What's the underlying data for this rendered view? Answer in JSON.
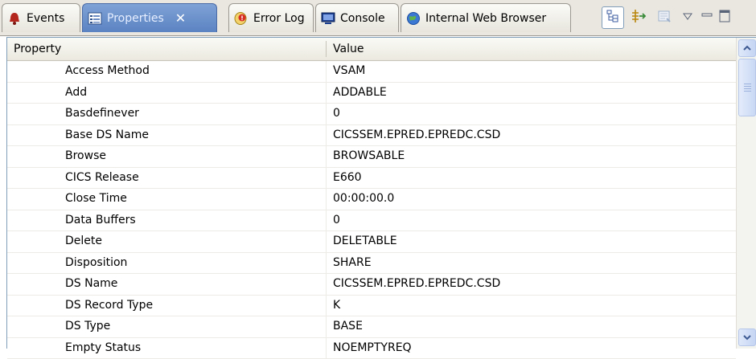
{
  "tabs": [
    {
      "label": "Events",
      "icon": "bell-icon"
    },
    {
      "label": "Properties",
      "icon": "properties-icon",
      "active": true
    },
    {
      "label": "Error Log",
      "icon": "error-log-icon"
    },
    {
      "label": "Console",
      "icon": "console-icon"
    },
    {
      "label": "Internal Web Browser",
      "icon": "globe-icon"
    }
  ],
  "toolbar": [
    {
      "icon": "show-categories-icon"
    },
    {
      "icon": "show-advanced-properties-icon"
    },
    {
      "icon": "restore-default-icon"
    },
    {
      "icon": "view-menu-icon"
    },
    {
      "icon": "minimize-icon"
    },
    {
      "icon": "maximize-icon"
    }
  ],
  "table": {
    "headers": {
      "property": "Property",
      "value": "Value"
    },
    "rows": [
      {
        "property": "Access Method",
        "value": "VSAM"
      },
      {
        "property": "Add",
        "value": "ADDABLE"
      },
      {
        "property": "Basdefinever",
        "value": "0"
      },
      {
        "property": "Base DS Name",
        "value": "CICSSEM.EPRED.EPREDC.CSD"
      },
      {
        "property": "Browse",
        "value": "BROWSABLE"
      },
      {
        "property": "CICS Release",
        "value": "E660"
      },
      {
        "property": "Close Time",
        "value": "00:00:00.0"
      },
      {
        "property": "Data Buffers",
        "value": "0"
      },
      {
        "property": "Delete",
        "value": "DELETABLE"
      },
      {
        "property": "Disposition",
        "value": "SHARE"
      },
      {
        "property": "DS Name",
        "value": "CICSSEM.EPRED.EPREDC.CSD"
      },
      {
        "property": "DS Record Type",
        "value": "K"
      },
      {
        "property": "DS Type",
        "value": "BASE"
      },
      {
        "property": "Empty Status",
        "value": "NOEMPTYREQ"
      }
    ]
  }
}
